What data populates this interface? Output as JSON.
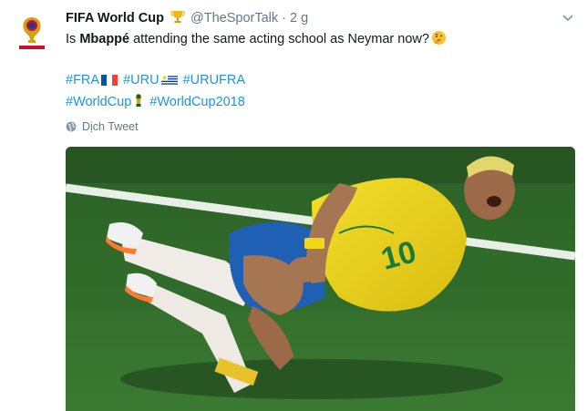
{
  "tweet": {
    "account_name": "FIFA World Cup",
    "handle": "@TheSporTalk",
    "separator": "·",
    "time": "2 g",
    "text_before": "Is ",
    "text_bold": "Mbappé",
    "text_after": " attending the same acting school as Neymar now?",
    "hashtags_line1": [
      "#FRA",
      "#URU",
      "#URUFRA"
    ],
    "hashtags_line2": [
      "#WorldCup",
      "#WorldCup2018"
    ],
    "translate_label": "Dịch Tweet",
    "jersey_number": "10",
    "icons": [
      "fifa-world-cup-logo-icon",
      "trophy-icon",
      "thinking-face-icon",
      "france-flag-icon",
      "uruguay-flag-icon",
      "world-cup-trophy-icon",
      "globe-icon",
      "chevron-down-icon"
    ]
  },
  "colors": {
    "link": "#1b95e0",
    "muted": "#657786",
    "text": "#14171a",
    "pitch": "#2f6e2a",
    "jersey": "#f2d81c",
    "shorts": "#1f5fb4"
  }
}
